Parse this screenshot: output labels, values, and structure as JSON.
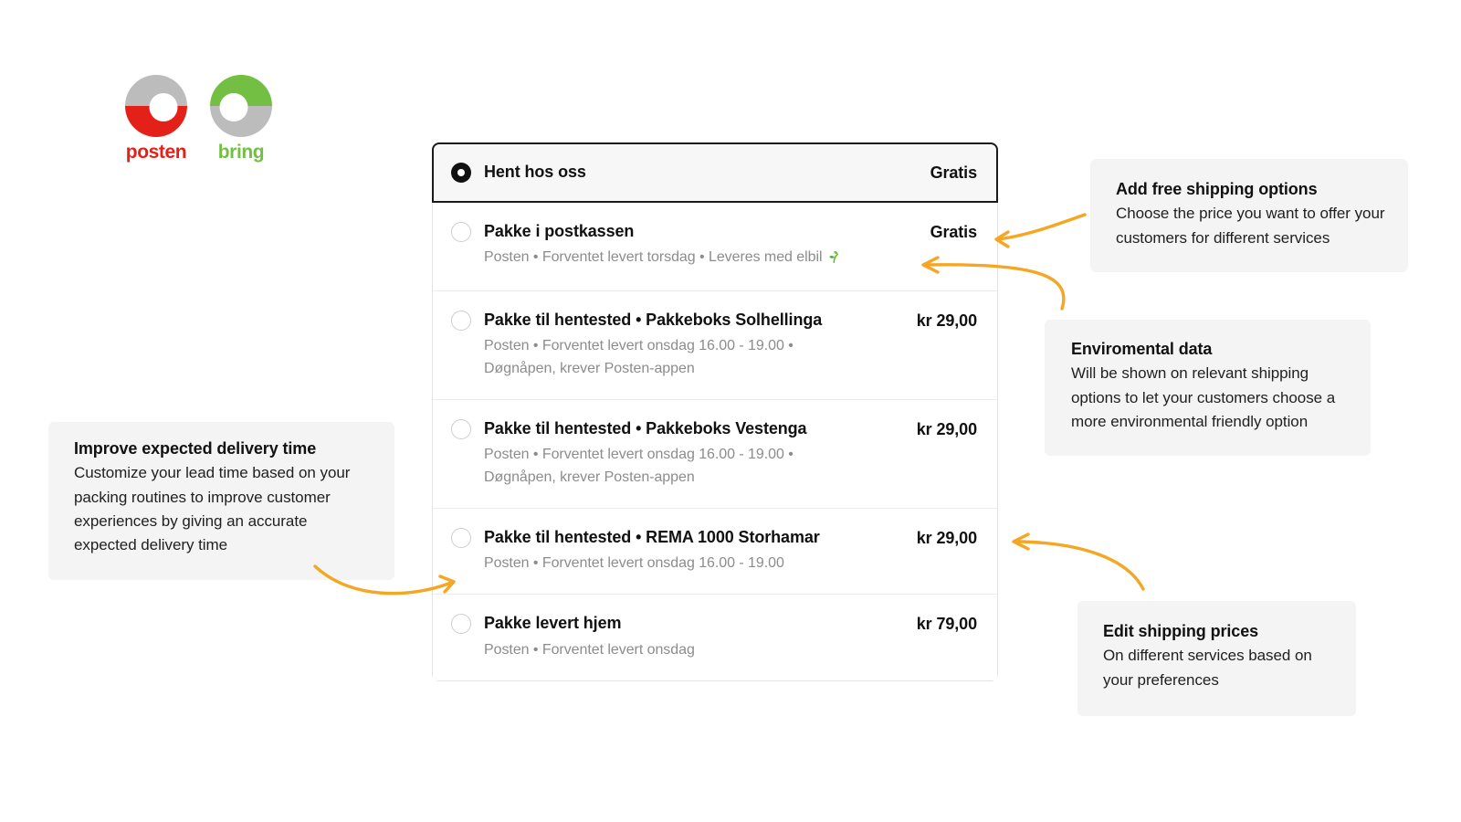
{
  "brand": {
    "logos": [
      {
        "name": "posten",
        "word": "posten",
        "color": "#e32118"
      },
      {
        "name": "bring",
        "word": "bring",
        "color": "#73bf44"
      }
    ]
  },
  "shipping_options": [
    {
      "id": "hent-hos-oss",
      "title": "Hent hos oss",
      "subtitle": "",
      "price": "Gratis",
      "selected": true,
      "eco": false
    },
    {
      "id": "pakke-i-postkassen",
      "title": "Pakke i postkassen",
      "subtitle": "Posten • Forventet levert torsdag • Leveres med elbil",
      "price": "Gratis",
      "selected": false,
      "eco": true
    },
    {
      "id": "pakkeboks-solhellinga",
      "title": "Pakke til hentested • Pakkeboks Solhellinga",
      "subtitle": "Posten • Forventet levert onsdag 16.00 - 19.00 • Døgnåpen, krever Posten-appen",
      "price": "kr 29,00",
      "selected": false,
      "eco": false
    },
    {
      "id": "pakkeboks-vestenga",
      "title": "Pakke til hentested • Pakkeboks Vestenga",
      "subtitle": "Posten • Forventet levert onsdag 16.00 - 19.00 • Døgnåpen, krever Posten-appen",
      "price": "kr 29,00",
      "selected": false,
      "eco": false
    },
    {
      "id": "rema-1000-storhamar",
      "title": "Pakke til hentested • REMA 1000 Storhamar",
      "subtitle": "Posten • Forventet levert onsdag 16.00 - 19.00",
      "price": "kr 29,00",
      "selected": false,
      "eco": false
    },
    {
      "id": "pakke-levert-hjem",
      "title": "Pakke levert hjem",
      "subtitle": "Posten • Forventet levert onsdag",
      "price": "kr 79,00",
      "selected": false,
      "eco": false
    }
  ],
  "callouts": {
    "free_shipping": {
      "title": "Add free shipping options",
      "text": "Choose the price you want to offer your customers for different services"
    },
    "environmental": {
      "title": "Enviromental data",
      "text": "Will be shown on relevant shipping options to let your customers choose a more environmental friendly option"
    },
    "lead_time": {
      "title": "Improve expected delivery time",
      "text": "Customize your lead time based on your packing routines to improve customer experiences by giving an accurate expected delivery time"
    },
    "prices": {
      "title": "Edit shipping prices",
      "text": "On different services based on your preferences"
    }
  },
  "colors": {
    "arrow": "#f5a623",
    "selected_border": "#1a1a1a",
    "selected_bg": "#f7f7f7",
    "callout_bg": "#f4f4f4",
    "muted_text": "#8c8c8c",
    "eco_green": "#5cb531",
    "posten_red": "#e32118",
    "bring_green": "#73bf44",
    "logo_gray": "#bcbcbc"
  }
}
